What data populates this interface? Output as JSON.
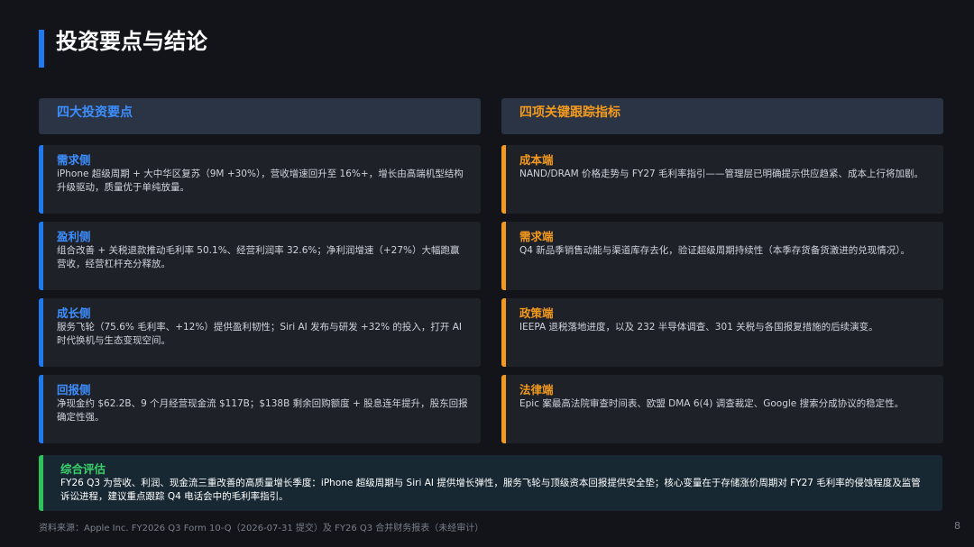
{
  "page": {
    "title": "投资要点与结论",
    "page_number": "8"
  },
  "left": {
    "header": "四大投资要点",
    "cards": [
      {
        "title": "需求侧",
        "body": "iPhone 超级周期 + 大中华区复苏（9M +30%），营收增速回升至 16%+，增长由高端机型结构升级驱动，质量优于单纯放量。"
      },
      {
        "title": "盈利侧",
        "body": "组合改善 + 关税退款推动毛利率 50.1%、经营利润率 32.6%；净利润增速（+27%）大幅跑赢营收，经营杠杆充分释放。"
      },
      {
        "title": "成长侧",
        "body": "服务飞轮（75.6% 毛利率、+12%）提供盈利韧性；Siri AI 发布与研发 +32% 的投入，打开 AI 时代换机与生态变现空间。"
      },
      {
        "title": "回报侧",
        "body": "净现金约 $62.2B、9 个月经营现金流 $117B；$138B 剩余回购额度 + 股息连年提升，股东回报确定性强。"
      }
    ]
  },
  "right": {
    "header": "四项关键跟踪指标",
    "cards": [
      {
        "title": "成本端",
        "body": "NAND/DRAM 价格走势与 FY27 毛利率指引——管理层已明确提示供应趋紧、成本上行将加剧。"
      },
      {
        "title": "需求端",
        "body": "Q4 新品季销售动能与渠道库存去化，验证超级周期持续性（本季存货备货激进的兑现情况）。"
      },
      {
        "title": "政策端",
        "body": "IEEPA 退税落地进度，以及 232 半导体调查、301 关税与各国报复措施的后续演变。"
      },
      {
        "title": "法律端",
        "body": "Epic 案最高法院审查时间表、欧盟 DMA 6(4) 调查裁定、Google 搜索分成协议的稳定性。"
      }
    ]
  },
  "summary": {
    "title": "综合评估",
    "body": "FY26 Q3 为营收、利润、现金流三重改善的高质量增长季度：iPhone 超级周期与 Siri AI 提供增长弹性，服务飞轮与顶级资本回报提供安全垫；核心变量在于存储涨价周期对 FY27 毛利率的侵蚀程度及监管诉讼进程，建议重点跟踪 Q4 电话会中的毛利率指引。"
  },
  "footer": {
    "source": "资料来源：Apple Inc. FY2026 Q3 Form 10-Q（2026-07-31 提交）及 FY26 Q3 合并财务报表（未经审计）"
  }
}
